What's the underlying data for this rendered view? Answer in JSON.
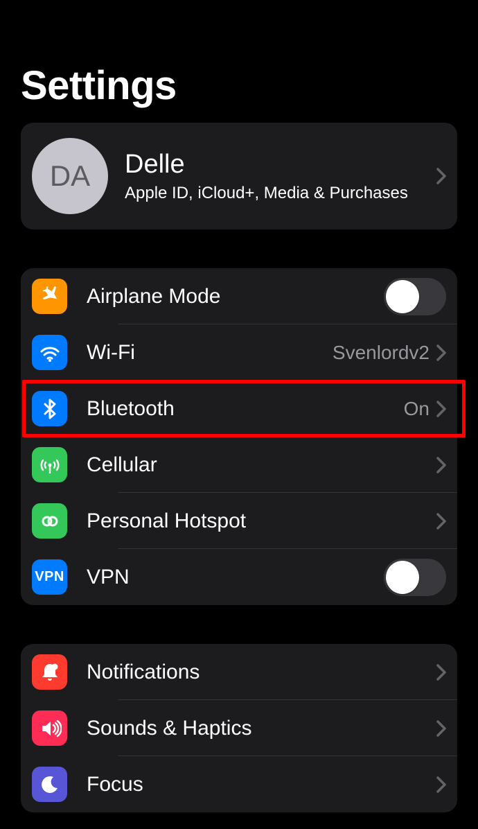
{
  "title": "Settings",
  "profile": {
    "initials": "DA",
    "name": "Delle",
    "subtitle": "Apple ID, iCloud+, Media & Purchases"
  },
  "connectivity": {
    "airplane": {
      "label": "Airplane Mode",
      "on": false,
      "color": "#ff9500"
    },
    "wifi": {
      "label": "Wi-Fi",
      "value": "Svenlordv2",
      "color": "#007aff"
    },
    "bluetooth": {
      "label": "Bluetooth",
      "value": "On",
      "color": "#007aff"
    },
    "cellular": {
      "label": "Cellular",
      "color": "#34c759"
    },
    "hotspot": {
      "label": "Personal Hotspot",
      "color": "#34c759"
    },
    "vpn": {
      "label": "VPN",
      "on": false,
      "color": "#007aff",
      "icon_text": "VPN"
    }
  },
  "section2": {
    "notifications": {
      "label": "Notifications",
      "color": "#ff3b30"
    },
    "sounds": {
      "label": "Sounds & Haptics",
      "color": "#ff2d55"
    },
    "focus": {
      "label": "Focus",
      "color": "#5856d6"
    }
  },
  "highlight": {
    "target": "bluetooth-row"
  }
}
